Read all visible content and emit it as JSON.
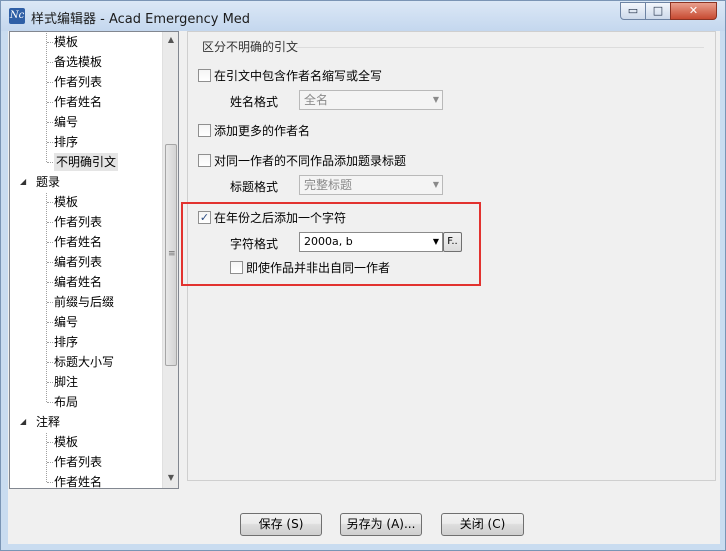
{
  "window": {
    "title": "样式编辑器 - Acad Emergency Med",
    "app_icon_text": "Nc",
    "controls": {
      "minimize": "▭",
      "maximize": "□",
      "close": "✕"
    }
  },
  "tree": {
    "items": [
      {
        "label": "模板",
        "level": 1
      },
      {
        "label": "备选模板",
        "level": 1
      },
      {
        "label": "作者列表",
        "level": 1
      },
      {
        "label": "作者姓名",
        "level": 1
      },
      {
        "label": "编号",
        "level": 1
      },
      {
        "label": "排序",
        "level": 1
      },
      {
        "label": "不明确引文",
        "level": 1,
        "selected": true
      },
      {
        "label": "题录",
        "level": 0,
        "expanded": true
      },
      {
        "label": "模板",
        "level": 1
      },
      {
        "label": "作者列表",
        "level": 1
      },
      {
        "label": "作者姓名",
        "level": 1
      },
      {
        "label": "编者列表",
        "level": 1
      },
      {
        "label": "编者姓名",
        "level": 1
      },
      {
        "label": "前缀与后缀",
        "level": 1
      },
      {
        "label": "编号",
        "level": 1
      },
      {
        "label": "排序",
        "level": 1
      },
      {
        "label": "标题大小写",
        "level": 1
      },
      {
        "label": "脚注",
        "level": 1
      },
      {
        "label": "布局",
        "level": 1
      },
      {
        "label": "注释",
        "level": 0,
        "expanded": true
      },
      {
        "label": "模板",
        "level": 1
      },
      {
        "label": "作者列表",
        "level": 1
      },
      {
        "label": "作者姓名",
        "level": 1
      }
    ],
    "expander_glyph": "◢",
    "scroll_up": "▲",
    "scroll_down": "▼",
    "grip": "≡"
  },
  "panel": {
    "section_title": "区分不明确的引文",
    "include_initials": {
      "label": "在引文中包含作者名缩写或全写",
      "checked": false
    },
    "name_format": {
      "label": "姓名格式",
      "value": "全名",
      "enabled": false
    },
    "add_more_authors": {
      "label": "添加更多的作者名",
      "checked": false
    },
    "add_title": {
      "label": "对同一作者的不同作品添加题录标题",
      "checked": false
    },
    "title_format": {
      "label": "标题格式",
      "value": "完整标题",
      "enabled": false
    },
    "add_char": {
      "label": "在年份之后添加一个字符",
      "checked": true,
      "check_glyph": "✓"
    },
    "char_format": {
      "label": "字符格式",
      "value": "2000a, b",
      "enabled": true,
      "button": "F.."
    },
    "even_if_not_same": {
      "label": "即使作品并非出自同一作者",
      "checked": false
    }
  },
  "buttons": {
    "save": "保存 (S)",
    "save_as": "另存为 (A)...",
    "close": "关闭 (C)"
  },
  "colors": {
    "highlight": "#e2322f",
    "close_button": "#c74a31"
  }
}
